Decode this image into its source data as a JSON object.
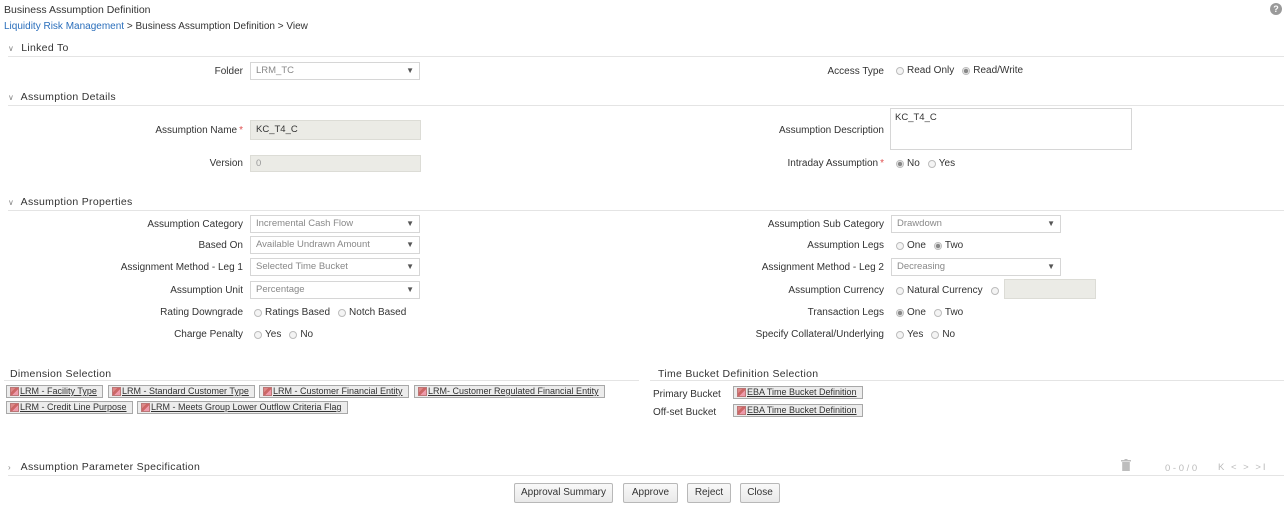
{
  "header": {
    "title": "Business Assumption Definition",
    "help_label": "?",
    "breadcrumb_link": "Liquidity Risk Management",
    "breadcrumb_rest": " > Business Assumption Definition > View"
  },
  "linked_to": {
    "section_title": "Linked To",
    "folder_label": "Folder",
    "folder_value": "LRM_TC",
    "access_type_label": "Access Type",
    "access_options": [
      "Read Only",
      "Read/Write"
    ]
  },
  "assumption_details": {
    "section_title": "Assumption Details",
    "name_label": "Assumption Name",
    "name_value": "KC_T4_C",
    "description_label": "Assumption Description",
    "description_value": "KC_T4_C",
    "version_label": "Version",
    "version_value": "0",
    "intraday_label": "Intraday Assumption",
    "intraday_options": [
      "No",
      "Yes"
    ]
  },
  "assumption_properties": {
    "section_title": "Assumption Properties",
    "category_label": "Assumption Category",
    "category_value": "Incremental Cash Flow",
    "sub_category_label": "Assumption Sub Category",
    "sub_category_value": "Drawdown",
    "based_on_label": "Based On",
    "based_on_value": "Available Undrawn Amount",
    "legs_label": "Assumption Legs",
    "legs_options": [
      "One",
      "Two"
    ],
    "method_leg1_label": "Assignment Method - Leg 1",
    "method_leg1_value": "Selected Time Bucket",
    "method_leg2_label": "Assignment Method - Leg 2",
    "method_leg2_value": "Decreasing",
    "unit_label": "Assumption Unit",
    "unit_value": "Percentage",
    "currency_label": "Assumption Currency",
    "currency_options": [
      "Natural Currency"
    ],
    "rating_label": "Rating Downgrade",
    "rating_options": [
      "Ratings Based",
      "Notch Based"
    ],
    "transaction_legs_label": "Transaction Legs",
    "transaction_legs_options": [
      "One",
      "Two"
    ],
    "charge_penalty_label": "Charge Penalty",
    "charge_penalty_options": [
      "Yes",
      "No"
    ],
    "collateral_label": "Specify Collateral/Underlying",
    "collateral_options": [
      "Yes",
      "No"
    ]
  },
  "dimension_selection": {
    "title": "Dimension Selection",
    "chips": [
      "LRM - Facility Type",
      "LRM - Standard Customer Type",
      "LRM - Customer Financial Entity",
      "LRM- Customer Regulated Financial Entity",
      "LRM - Credit Line Purpose",
      "LRM - Meets Group Lower Outflow Criteria Flag"
    ]
  },
  "time_bucket": {
    "title": "Time Bucket Definition Selection",
    "primary_label": "Primary Bucket",
    "primary_value": "EBA Time Bucket Definition",
    "offset_label": "Off-set Bucket",
    "offset_value": "EBA Time Bucket Definition"
  },
  "parameter_spec": {
    "section_title": "Assumption Parameter Specification",
    "pager_text": "0 - 0 / 0",
    "pager_icons": "K  <  >  >I"
  },
  "buttons": {
    "approval_summary": "Approval Summary",
    "approve": "Approve",
    "reject": "Reject",
    "close": "Close"
  },
  "colors": {
    "link": "#2a6ebb",
    "required": "#e05050",
    "readonly_bg": "#ebebe6"
  }
}
